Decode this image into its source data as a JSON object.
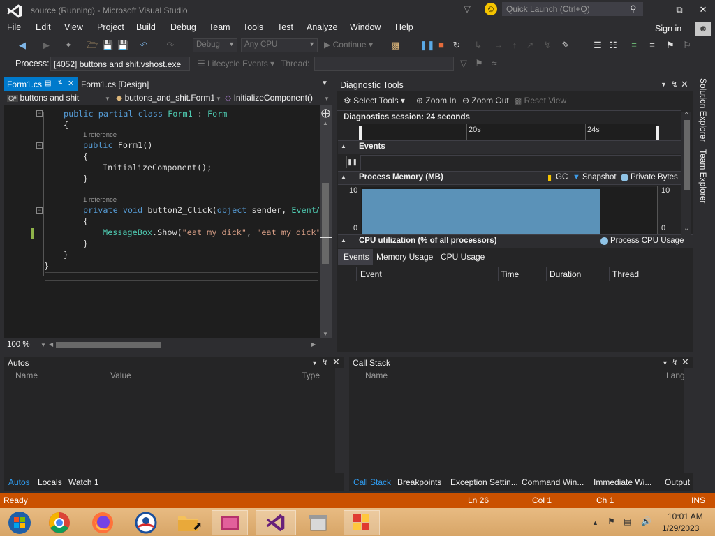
{
  "window": {
    "title": "source (Running) - Microsoft Visual Studio",
    "quick_launch_placeholder": "Quick Launch (Ctrl+Q)",
    "minimize": "–",
    "maximize": "⧉",
    "close": "✕"
  },
  "menu": {
    "items": [
      "File",
      "Edit",
      "View",
      "Project",
      "Build",
      "Debug",
      "Team",
      "Tools",
      "Test",
      "Analyze",
      "Window",
      "Help"
    ],
    "sign_in": "Sign in"
  },
  "toolbar": {
    "config": "Debug",
    "platform": "Any CPU",
    "continue": "Continue"
  },
  "process_bar": {
    "label": "Process:",
    "process": "[4052] buttons and shit.vshost.exe",
    "lifecycle": "Lifecycle Events",
    "thread_label": "Thread:"
  },
  "editor": {
    "tabs": [
      {
        "label": "Form1.cs",
        "active": true
      },
      {
        "label": "Form1.cs [Design]",
        "active": false
      }
    ],
    "nav": {
      "project": "buttons and shit",
      "class": "buttons_and_shit.Form1",
      "member": "InitializeComponent()"
    },
    "code": {
      "line1_kw": "public partial class ",
      "line1_type": "Form1",
      "line1_sep": " : ",
      "line1_base": "Form",
      "open_brace": "{",
      "close_brace": "}",
      "ref1": "1 reference",
      "line2_kw": "public ",
      "line2_rest": "Form1()",
      "init": "InitializeComponent();",
      "ref2": "1 reference",
      "line3_kw": "private void ",
      "line3_rest": "button2_Click(",
      "line3_kw2": "object",
      "line3_rest2": " sender, ",
      "line3_type": "EventArgs",
      "msg_type": "MessageBox",
      "msg_call": ".Show(",
      "msg_str1": "\"eat my dick\"",
      "msg_comma": ", ",
      "msg_str2": "\"eat my dick\""
    },
    "zoom": "100 %"
  },
  "diagnostics": {
    "title": "Diagnostic Tools",
    "select_tools": "Select Tools",
    "zoom_in": "Zoom In",
    "zoom_out": "Zoom Out",
    "reset_view": "Reset View",
    "session": "Diagnostics session: 24 seconds",
    "timeline_ticks": [
      "20s",
      "24s"
    ],
    "events_label": "Events",
    "memory": {
      "label": "Process Memory (MB)",
      "legend": [
        "GC",
        "Snapshot",
        "Private Bytes"
      ],
      "y_max": "10",
      "y_min": "0"
    },
    "cpu": {
      "label": "CPU utilization (% of all processors)",
      "legend": "Process CPU Usage"
    },
    "tabs": [
      "Events",
      "Memory Usage",
      "CPU Usage"
    ],
    "columns": [
      "Event",
      "Time",
      "Duration",
      "Thread"
    ]
  },
  "autos": {
    "title": "Autos",
    "columns": [
      "Name",
      "Value",
      "Type"
    ],
    "tabs": [
      "Autos",
      "Locals",
      "Watch 1"
    ]
  },
  "callstack": {
    "title": "Call Stack",
    "columns": [
      "Name",
      "Lang"
    ],
    "tabs": [
      "Call Stack",
      "Breakpoints",
      "Exception Settin...",
      "Command Win...",
      "Immediate Wi...",
      "Output"
    ]
  },
  "side_tabs": [
    "Solution Explorer",
    "Team Explorer"
  ],
  "status": {
    "state": "Ready",
    "line": "Ln 26",
    "col": "Col 1",
    "ch": "Ch 1",
    "mode": "INS"
  },
  "taskbar": {
    "time": "10:01 AM",
    "date": "1/29/2023"
  },
  "colors": {
    "accent": "#007acc",
    "status_bar": "#ca5100",
    "memory_fill": "#5b92b8"
  }
}
